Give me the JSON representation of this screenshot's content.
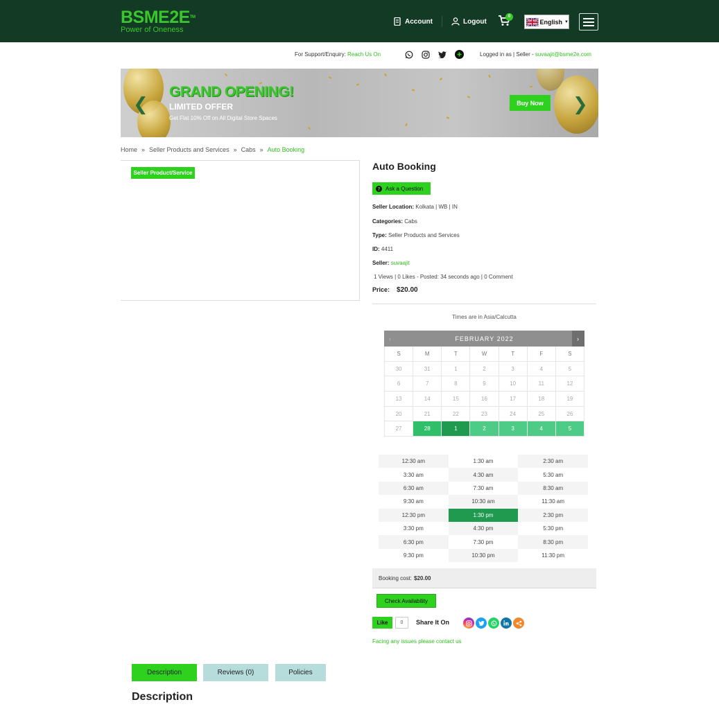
{
  "header": {
    "logo": "BSME2E",
    "logo_tm": "TM",
    "tagline": "Power of Oneness",
    "account_label": "Account",
    "logout_label": "Logout",
    "cart_count": "0",
    "language": "English"
  },
  "support": {
    "text": "For Support/Enquiry:",
    "link": "Reach Us On",
    "logged_in": "Logged in as | Seller -",
    "email": "suvaajit@bsme2e.com"
  },
  "banner": {
    "headline": "GRAND OPENING!",
    "subheadline": "LIMITED OFFER",
    "offer": "Get Flat 10% Off on All Digital Store Spaces",
    "cta": "Buy Now"
  },
  "breadcrumb": {
    "items": [
      "Home",
      "Seller Products and Services",
      "Cabs"
    ],
    "current": "Auto Booking",
    "separator": "»"
  },
  "product": {
    "badge": "Seller Product/Service",
    "title": "Auto Booking",
    "ask_label": "Ask a Question",
    "location_label": "Seller Location:",
    "location": "Kolkata | WB | IN",
    "categories_label": "Categories:",
    "categories": "Cabs",
    "type_label": "Type:",
    "type": "Seller Products and Services",
    "id_label": "ID:",
    "id": "4411",
    "seller_label": "Seller:",
    "seller": "suvaajit",
    "stats": "1 Views | 0 Likes - Posted: 34 seconds ago | 0 Comment",
    "price_label": "Price:",
    "price": "$20.00"
  },
  "booking": {
    "timezone": "Times are in Asia/Calcutta",
    "month": "FEBRUARY 2022",
    "prev": "‹",
    "next": "›",
    "weekdays": [
      "S",
      "M",
      "T",
      "W",
      "T",
      "F",
      "S"
    ],
    "days": [
      [
        "30",
        "31",
        "1",
        "2",
        "3",
        "4",
        "5"
      ],
      [
        "6",
        "7",
        "8",
        "9",
        "10",
        "11",
        "12"
      ],
      [
        "13",
        "14",
        "15",
        "16",
        "17",
        "18",
        "19"
      ],
      [
        "20",
        "21",
        "22",
        "23",
        "24",
        "25",
        "26"
      ],
      [
        "27",
        "28",
        "1",
        "2",
        "3",
        "4",
        "5"
      ]
    ],
    "times": [
      "12:30 am",
      "1:30 am",
      "2:30 am",
      "3:30 am",
      "4:30 am",
      "5:30 am",
      "6:30 am",
      "7:30 am",
      "8:30 am",
      "9:30 am",
      "10:30 am",
      "11:30 am",
      "12:30 pm",
      "1:30 pm",
      "2:30 pm",
      "3:30 pm",
      "4:30 pm",
      "5:30 pm",
      "6:30 pm",
      "7:30 pm",
      "8:30 pm",
      "9:30 pm",
      "10:30 pm",
      "11:30 pm"
    ],
    "selected_time": "1:30 pm",
    "cost_label": "Booking cost:",
    "cost": "$20.00",
    "check_label": "Check Availability"
  },
  "social": {
    "like_label": "Like",
    "like_count": "0",
    "share_label": "Share It On",
    "issues_text": "Facing any issues please contact us"
  },
  "tabs": {
    "description": "Description",
    "reviews": "Reviews (0)",
    "policies": "Policies"
  },
  "section": {
    "title": "Description"
  },
  "colors": {
    "header_bg": "#123a24",
    "brand_green": "#2fd11f",
    "calendar_available": "#4ecb86",
    "calendar_selected": "#1f9a4e"
  }
}
